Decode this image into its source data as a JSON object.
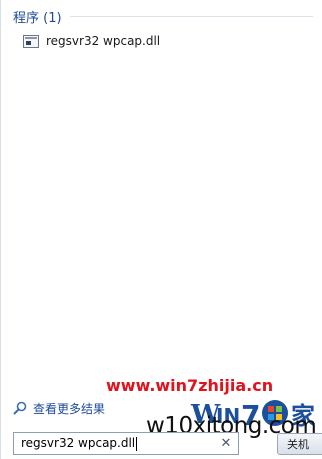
{
  "results": {
    "section_title": "程序 (1)",
    "items": [
      {
        "label": "regsvr32 wpcap.dll",
        "icon": "application-window-icon"
      }
    ]
  },
  "see_more": {
    "label": "查看更多结果",
    "icon": "magnifier-icon"
  },
  "search": {
    "value": "regsvr32 wpcap.dll",
    "clear_symbol": "✕"
  },
  "shutdown": {
    "label": "关机"
  },
  "watermark": {
    "url": "www.win7zhijia.cn",
    "logo_text": "Win7之家",
    "site": "w10xitong.com"
  },
  "colors": {
    "link_blue": "#1e4a9a",
    "watermark_red": "#e0121b"
  }
}
